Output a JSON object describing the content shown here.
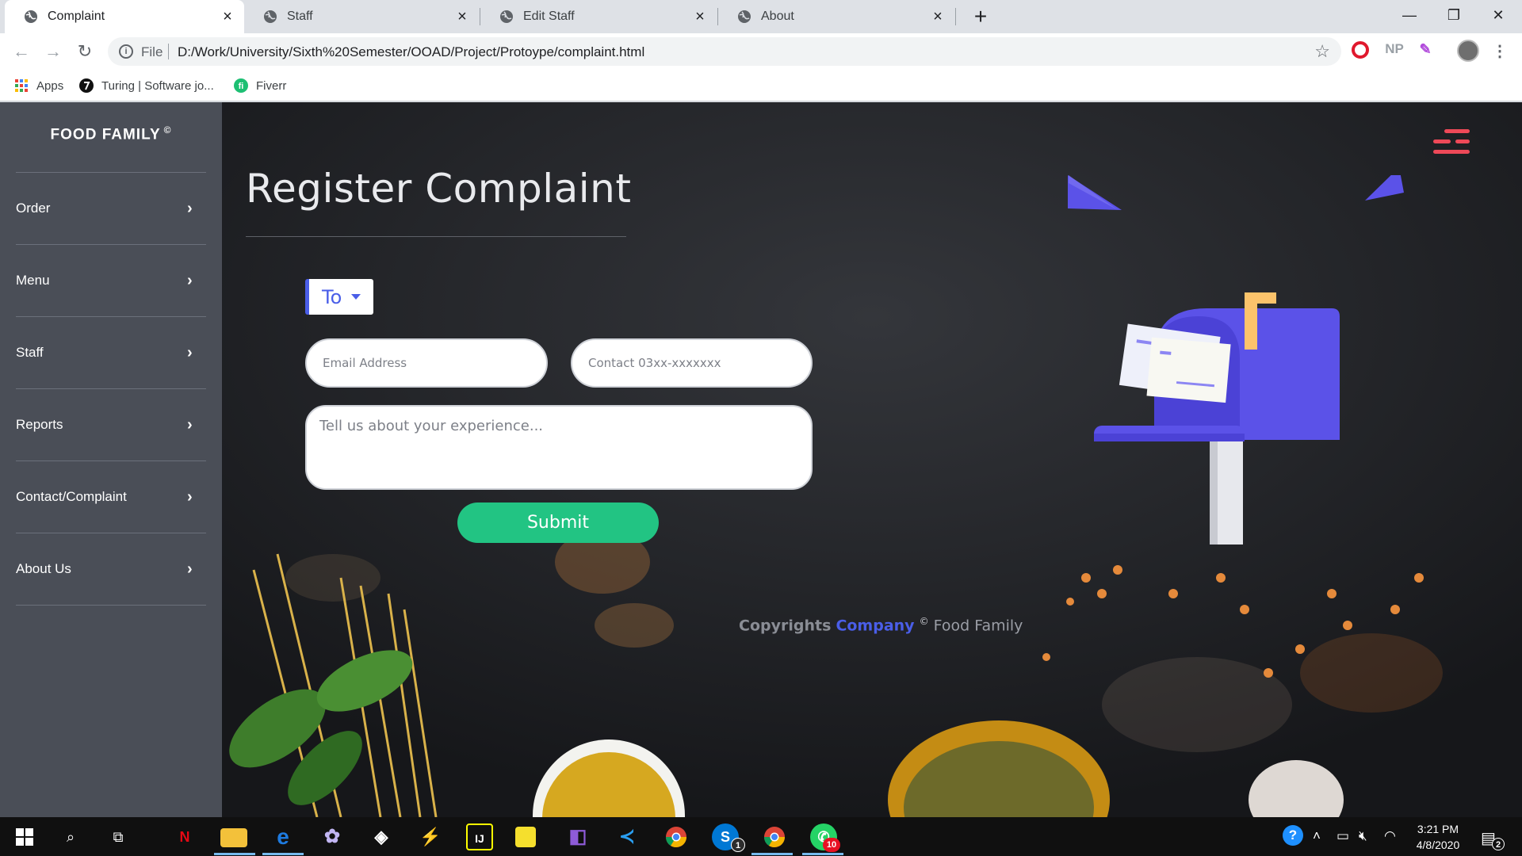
{
  "browser": {
    "tabs": [
      {
        "title": "Complaint",
        "active": true
      },
      {
        "title": "Staff",
        "active": false
      },
      {
        "title": "Edit Staff",
        "active": false
      },
      {
        "title": "About",
        "active": false
      }
    ],
    "new_tab_glyph": "+",
    "window_controls": {
      "minimize": "—",
      "maximize": "❐",
      "close": "✕"
    },
    "address": {
      "scheme": "File",
      "url": "D:/Work/University/Sixth%20Semester/OOAD/Project/Protoype/complaint.html"
    },
    "extensions": [
      "NP"
    ],
    "bookmarks": [
      {
        "label": "Apps",
        "icon": "apps-grid-icon"
      },
      {
        "label": "Turing | Software jo...",
        "icon": "turing-icon"
      },
      {
        "label": "Fiverr",
        "icon": "fiverr-icon"
      }
    ]
  },
  "sidebar": {
    "brand": "FOOD FAMILY",
    "brand_mark": "©",
    "items": [
      {
        "label": "Order"
      },
      {
        "label": "Menu"
      },
      {
        "label": "Staff"
      },
      {
        "label": "Reports"
      },
      {
        "label": "Contact/Complaint"
      },
      {
        "label": "About Us"
      }
    ],
    "chevron": "›"
  },
  "main": {
    "title": "Register Complaint",
    "to_button": "To",
    "email_placeholder": "Email Address",
    "contact_placeholder": "Contact 03xx-xxxxxxx",
    "experience_placeholder": "Tell us about your experience...",
    "submit_label": "Submit",
    "footer": {
      "prefix": "Copyrights",
      "company": "Company",
      "mark": "©",
      "suffix": "Food Family"
    },
    "colors": {
      "accent": "#4a5ee8",
      "submit": "#22c483",
      "menu": "#ee4958",
      "sidebar": "#4a4e57"
    }
  },
  "taskbar": {
    "time": "3:21 PM",
    "date": "4/8/2020",
    "badges": {
      "skype": "1",
      "whatsapp": "10",
      "notifications": "2"
    }
  }
}
